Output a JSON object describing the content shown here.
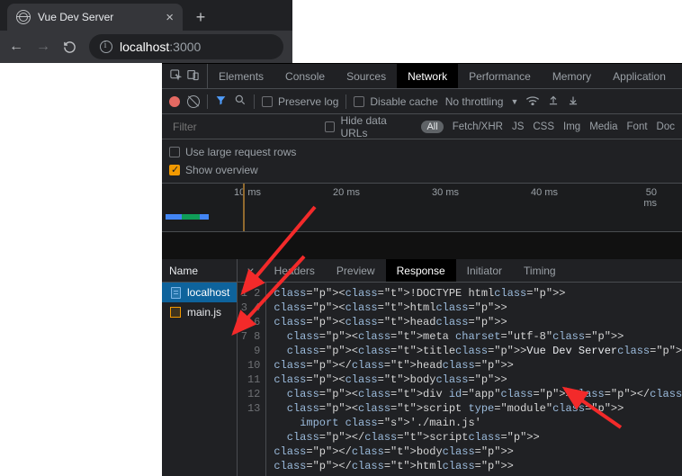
{
  "browser": {
    "tab_title": "Vue Dev Server",
    "url_host": "localhost",
    "url_port": ":3000"
  },
  "devtools": {
    "tabs": [
      "Elements",
      "Console",
      "Sources",
      "Network",
      "Performance",
      "Memory",
      "Application"
    ],
    "active_tab": "Network",
    "toolbar": {
      "preserve_log": "Preserve log",
      "disable_cache": "Disable cache",
      "throttling": "No throttling"
    },
    "filter": {
      "placeholder": "Filter",
      "hide_data_urls": "Hide data URLs",
      "all": "All",
      "types": [
        "Fetch/XHR",
        "JS",
        "CSS",
        "Img",
        "Media",
        "Font",
        "Doc"
      ]
    },
    "options": {
      "large_rows": "Use large request rows",
      "show_overview": "Show overview"
    },
    "timeline": {
      "ticks": [
        "10 ms",
        "20 ms",
        "30 ms",
        "40 ms",
        "50 ms"
      ]
    },
    "requests": {
      "header": "Name",
      "items": [
        {
          "name": "localhost",
          "kind": "doc"
        },
        {
          "name": "main.js",
          "kind": "js"
        }
      ]
    },
    "detail": {
      "tabs": [
        "Headers",
        "Preview",
        "Response",
        "Initiator",
        "Timing"
      ],
      "active": "Response",
      "code_lines": [
        "<!DOCTYPE html>",
        "<html>",
        "<head>",
        "  <meta charset=\"utf-8\">",
        "  <title>Vue Dev Server</title>",
        "</head>",
        "<body>",
        "  <div id=\"app\"></div>",
        "  <script type=\"module\">",
        "    import './main.js'",
        "  </script>",
        "</body>",
        "</html>"
      ]
    }
  }
}
